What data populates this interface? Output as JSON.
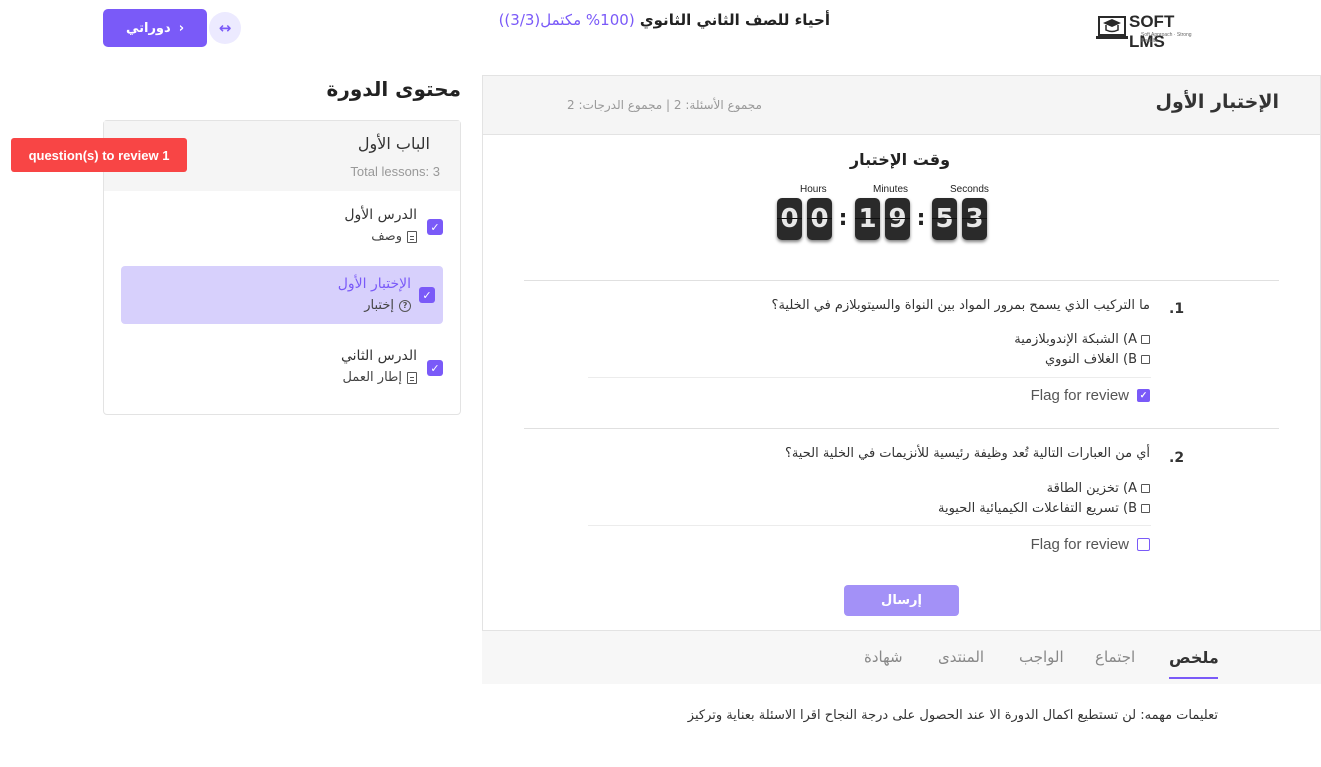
{
  "brand": {
    "logo_text": "SOFT LMS",
    "logo_tagline": "Soft Approach · Strong Results"
  },
  "header": {
    "course_title": "أحياء للصف الثاني الثانوي",
    "progress_text": "(100% مكتمل(3/3))",
    "my_courses_label": "دوراتي",
    "my_courses_icon": "chevron-right-icon",
    "expand_icon": "expand-horizontal-icon"
  },
  "sidebar": {
    "title": "محتوى الدورة",
    "review_badge": "question(s) to review 1",
    "chapter": {
      "title": "الباب الأول",
      "subtitle": "Total lessons: 3",
      "items": [
        {
          "name": "الدرس الأول",
          "type": "وصف",
          "type_icon": "document-icon",
          "completed": true,
          "active": false
        },
        {
          "name": "الإختبار الأول",
          "type": "إختبار",
          "type_icon": "question-circle-icon",
          "completed": true,
          "active": true
        },
        {
          "name": "الدرس الثاني",
          "type": "إطار العمل",
          "type_icon": "document-icon",
          "completed": true,
          "active": false
        }
      ]
    }
  },
  "quiz": {
    "title": "الإختبار الأول",
    "meta": "مجموع الأسئلة: 2 | مجموع الدرجات: 2",
    "timer": {
      "title": "وقت الإختبار",
      "units": [
        "Hours",
        "Minutes",
        "Seconds"
      ],
      "hours": "00",
      "minutes": "19",
      "seconds": "53",
      "digits": [
        "0",
        "0",
        "1",
        "9",
        "5",
        "3"
      ]
    },
    "questions": [
      {
        "number": ".1",
        "text": "ما التركيب الذي يسمح بمرور المواد بين النواة والسيتوبلازم في الخلية؟",
        "options": [
          {
            "label": "A) الشبكة الإندوبلازمية",
            "checked": false
          },
          {
            "label": "B) الغلاف النووي",
            "checked": false
          }
        ],
        "flag_label": "Flag for review",
        "flagged": true
      },
      {
        "number": ".2",
        "text": "أي من العبارات التالية تُعد وظيفة رئيسية للأنزيمات في الخلية الحية؟",
        "options": [
          {
            "label": "A) تخزين الطاقة",
            "checked": false
          },
          {
            "label": "B) تسريع التفاعلات الكيميائية الحيوية",
            "checked": false
          }
        ],
        "flag_label": "Flag for review",
        "flagged": false
      }
    ],
    "submit_label": "إرسال"
  },
  "tabs": {
    "items": [
      {
        "label": "ملخص",
        "active": true
      },
      {
        "label": "اجتماع",
        "active": false
      },
      {
        "label": "الواجب",
        "active": false
      },
      {
        "label": "المنتدى",
        "active": false
      },
      {
        "label": "شهادة",
        "active": false
      }
    ]
  },
  "instructions": "تعليمات مهمه: لن تستطيع اكمال الدورة الا عند الحصول على درجة النجاح اقرا الاسئلة بعناية وتركيز",
  "colors": {
    "accent": "#7a5af8",
    "badge": "#f84545",
    "active_item_bg": "#d7d0fc"
  }
}
